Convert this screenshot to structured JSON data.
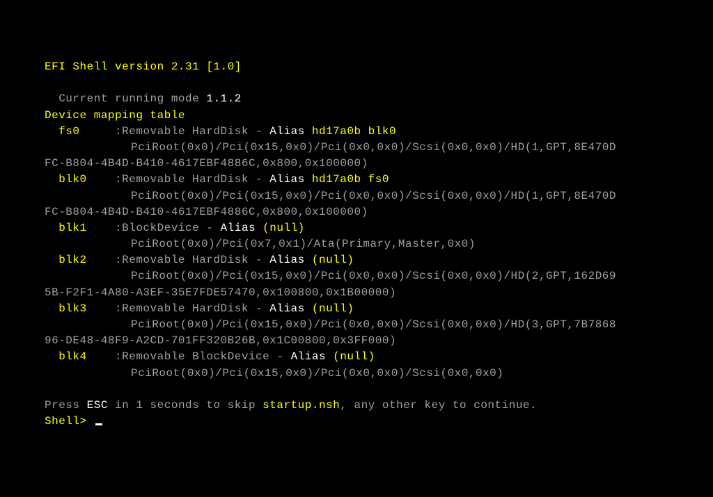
{
  "header": {
    "efi_shell": "EFI Shell version 2.31 [1.0]",
    "current_mode_label": "Current running mode ",
    "current_mode_value": "1.1.2",
    "device_mapping_title": "Device mapping table"
  },
  "devices": [
    {
      "name": "fs0",
      "desc": ":Removable HardDisk - ",
      "alias_label": "Alias ",
      "alias_value": "hd17a0b blk0",
      "path1": "PciRoot(0x0)/Pci(0x15,0x0)/Pci(0x0,0x0)/Scsi(0x0,0x0)/HD(1,GPT,8E470D",
      "path2": "FC-B804-4B4D-B410-4617EBF4886C,0x800,0x100000)"
    },
    {
      "name": "blk0",
      "desc": ":Removable HardDisk - ",
      "alias_label": "Alias ",
      "alias_value": "hd17a0b fs0",
      "path1": "PciRoot(0x0)/Pci(0x15,0x0)/Pci(0x0,0x0)/Scsi(0x0,0x0)/HD(1,GPT,8E470D",
      "path2": "FC-B804-4B4D-B410-4617EBF4886C,0x800,0x100000)"
    },
    {
      "name": "blk1",
      "desc": ":BlockDevice - ",
      "alias_label": "Alias ",
      "alias_value": "(null)",
      "path1": "PciRoot(0x0)/Pci(0x7,0x1)/Ata(Primary,Master,0x0)",
      "path2": ""
    },
    {
      "name": "blk2",
      "desc": ":Removable HardDisk - ",
      "alias_label": "Alias ",
      "alias_value": "(null)",
      "path1": "PciRoot(0x0)/Pci(0x15,0x0)/Pci(0x0,0x0)/Scsi(0x0,0x0)/HD(2,GPT,162D69",
      "path2": "5B-F2F1-4A80-A3EF-35E7FDE57470,0x100800,0x1B00000)"
    },
    {
      "name": "blk3",
      "desc": ":Removable HardDisk - ",
      "alias_label": "Alias ",
      "alias_value": "(null)",
      "path1": "PciRoot(0x0)/Pci(0x15,0x0)/Pci(0x0,0x0)/Scsi(0x0,0x0)/HD(3,GPT,7B7868",
      "path2": "96-DE48-48F9-A2CD-701FF320B26B,0x1C00800,0x3FF000)"
    },
    {
      "name": "blk4",
      "desc": ":Removable BlockDevice - ",
      "alias_label": "Alias ",
      "alias_value": "(null)",
      "path1": "PciRoot(0x0)/Pci(0x15,0x0)/Pci(0x0,0x0)/Scsi(0x0,0x0)",
      "path2": ""
    }
  ],
  "footer": {
    "press": "Press ",
    "esc": "ESC",
    "in_seconds": " in 1 seconds to skip ",
    "startup": "startup.nsh",
    "continue": ", any other key to continue.",
    "prompt": "Shell> "
  }
}
